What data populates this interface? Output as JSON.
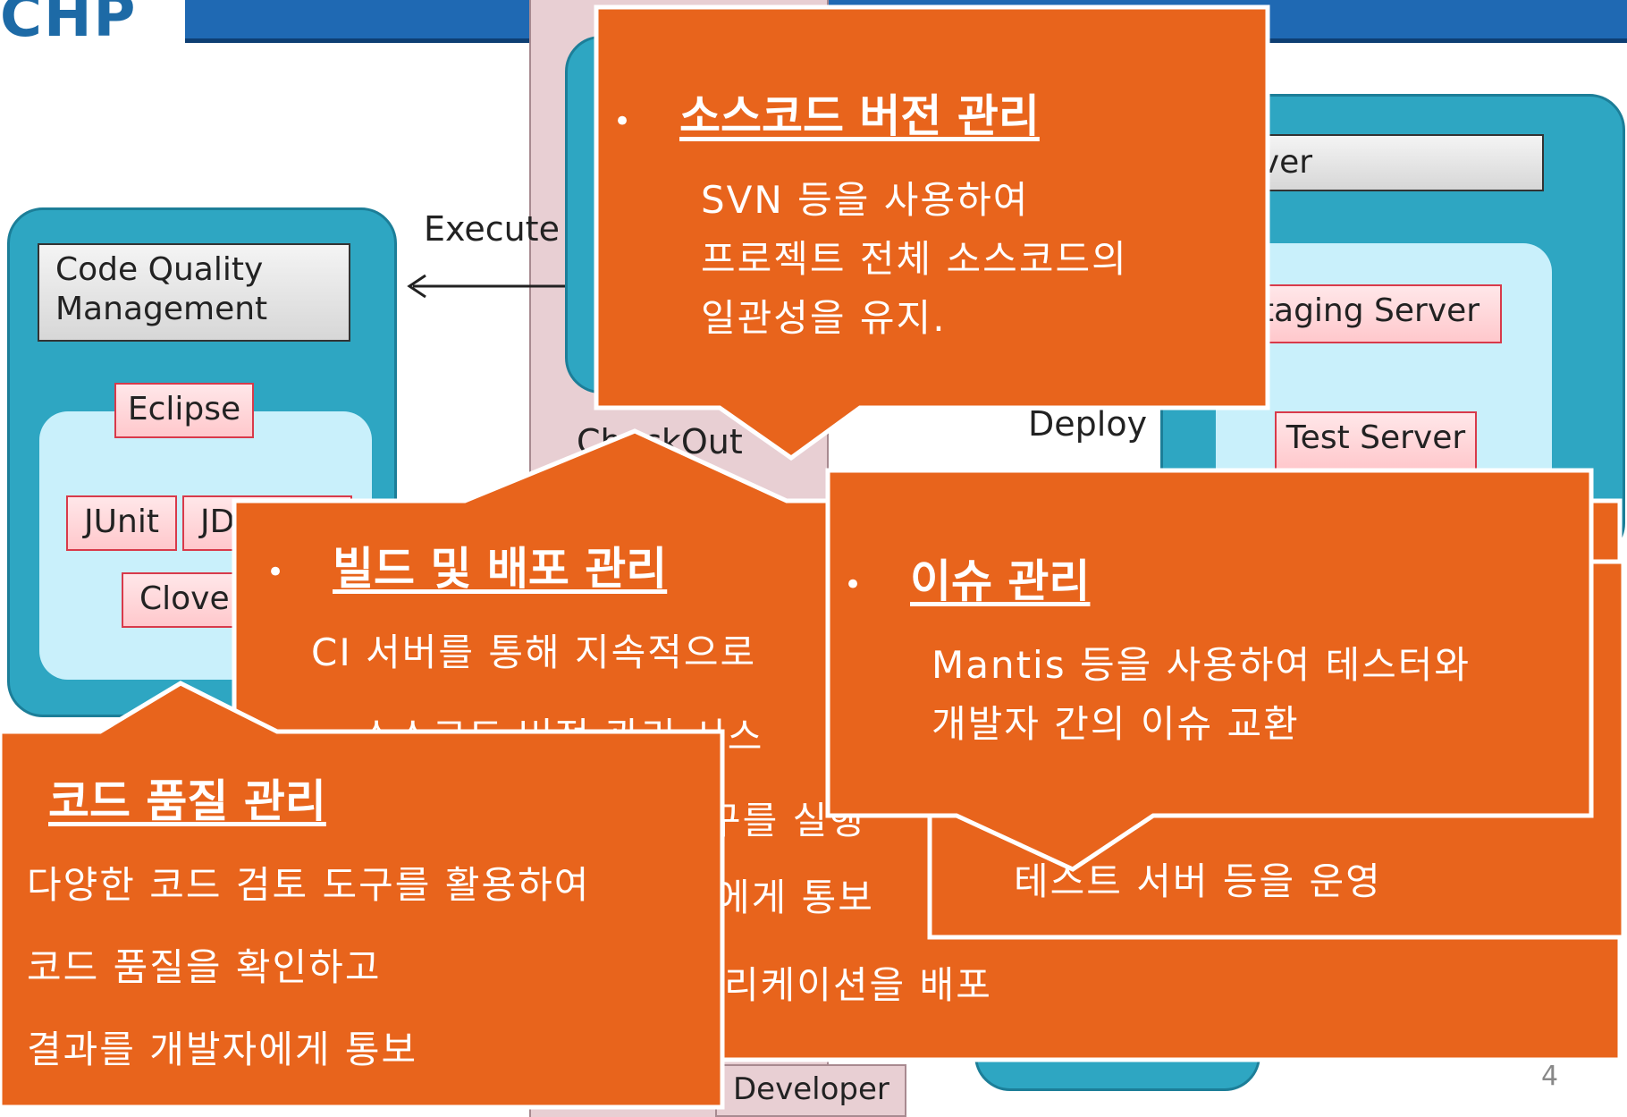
{
  "header": {
    "logo": "CHP"
  },
  "diagram": {
    "code_quality_title": "Code Quality\nManagement",
    "eclipse": "Eclipse",
    "junit": "JUnit",
    "jd_partial": "JD",
    "clover_partial": "Clover",
    "execute_label": "Execute",
    "checkout_label": "CheckOut",
    "deploy_label": "Deploy",
    "server_partial": "rver",
    "staging_partial": "taging Server",
    "test_server": "Test Server",
    "developer": "Developer",
    "page_number": "4"
  },
  "callouts": {
    "scm": {
      "bullet": "•",
      "heading": "소스코드 버전 관리",
      "lines": [
        "SVN 등을 사용하여",
        "프로젝트 전체 소스코드의",
        "일관성을 유지."
      ]
    },
    "build": {
      "bullet": "•",
      "heading": "빌드 및 배포 관리",
      "lines": [
        "CI 서버를 통해 지속적으로",
        "소스코드 버전 관리 시스",
        "구를 실행",
        "에게 통보",
        "리케이션을 배포"
      ]
    },
    "issue": {
      "bullet": "•",
      "heading": "이슈 관리",
      "lines": [
        "Mantis 등을 사용하여 테스터와",
        "개발자 간의 이슈 교환"
      ]
    },
    "test": {
      "lines": [
        "테스트 서버 등을 운영"
      ]
    },
    "quality": {
      "heading": "코드 품질 관리",
      "lines": [
        "다양한 코드 검토 도구를 활용하여",
        "코드 품질을 확인하고",
        "결과를 개발자에게 통보"
      ]
    }
  },
  "colors": {
    "callout_fill": "#e8641c",
    "callout_border": "#ffffff",
    "teal": "#2ea6c2",
    "title_bar": "#1f69b3"
  }
}
